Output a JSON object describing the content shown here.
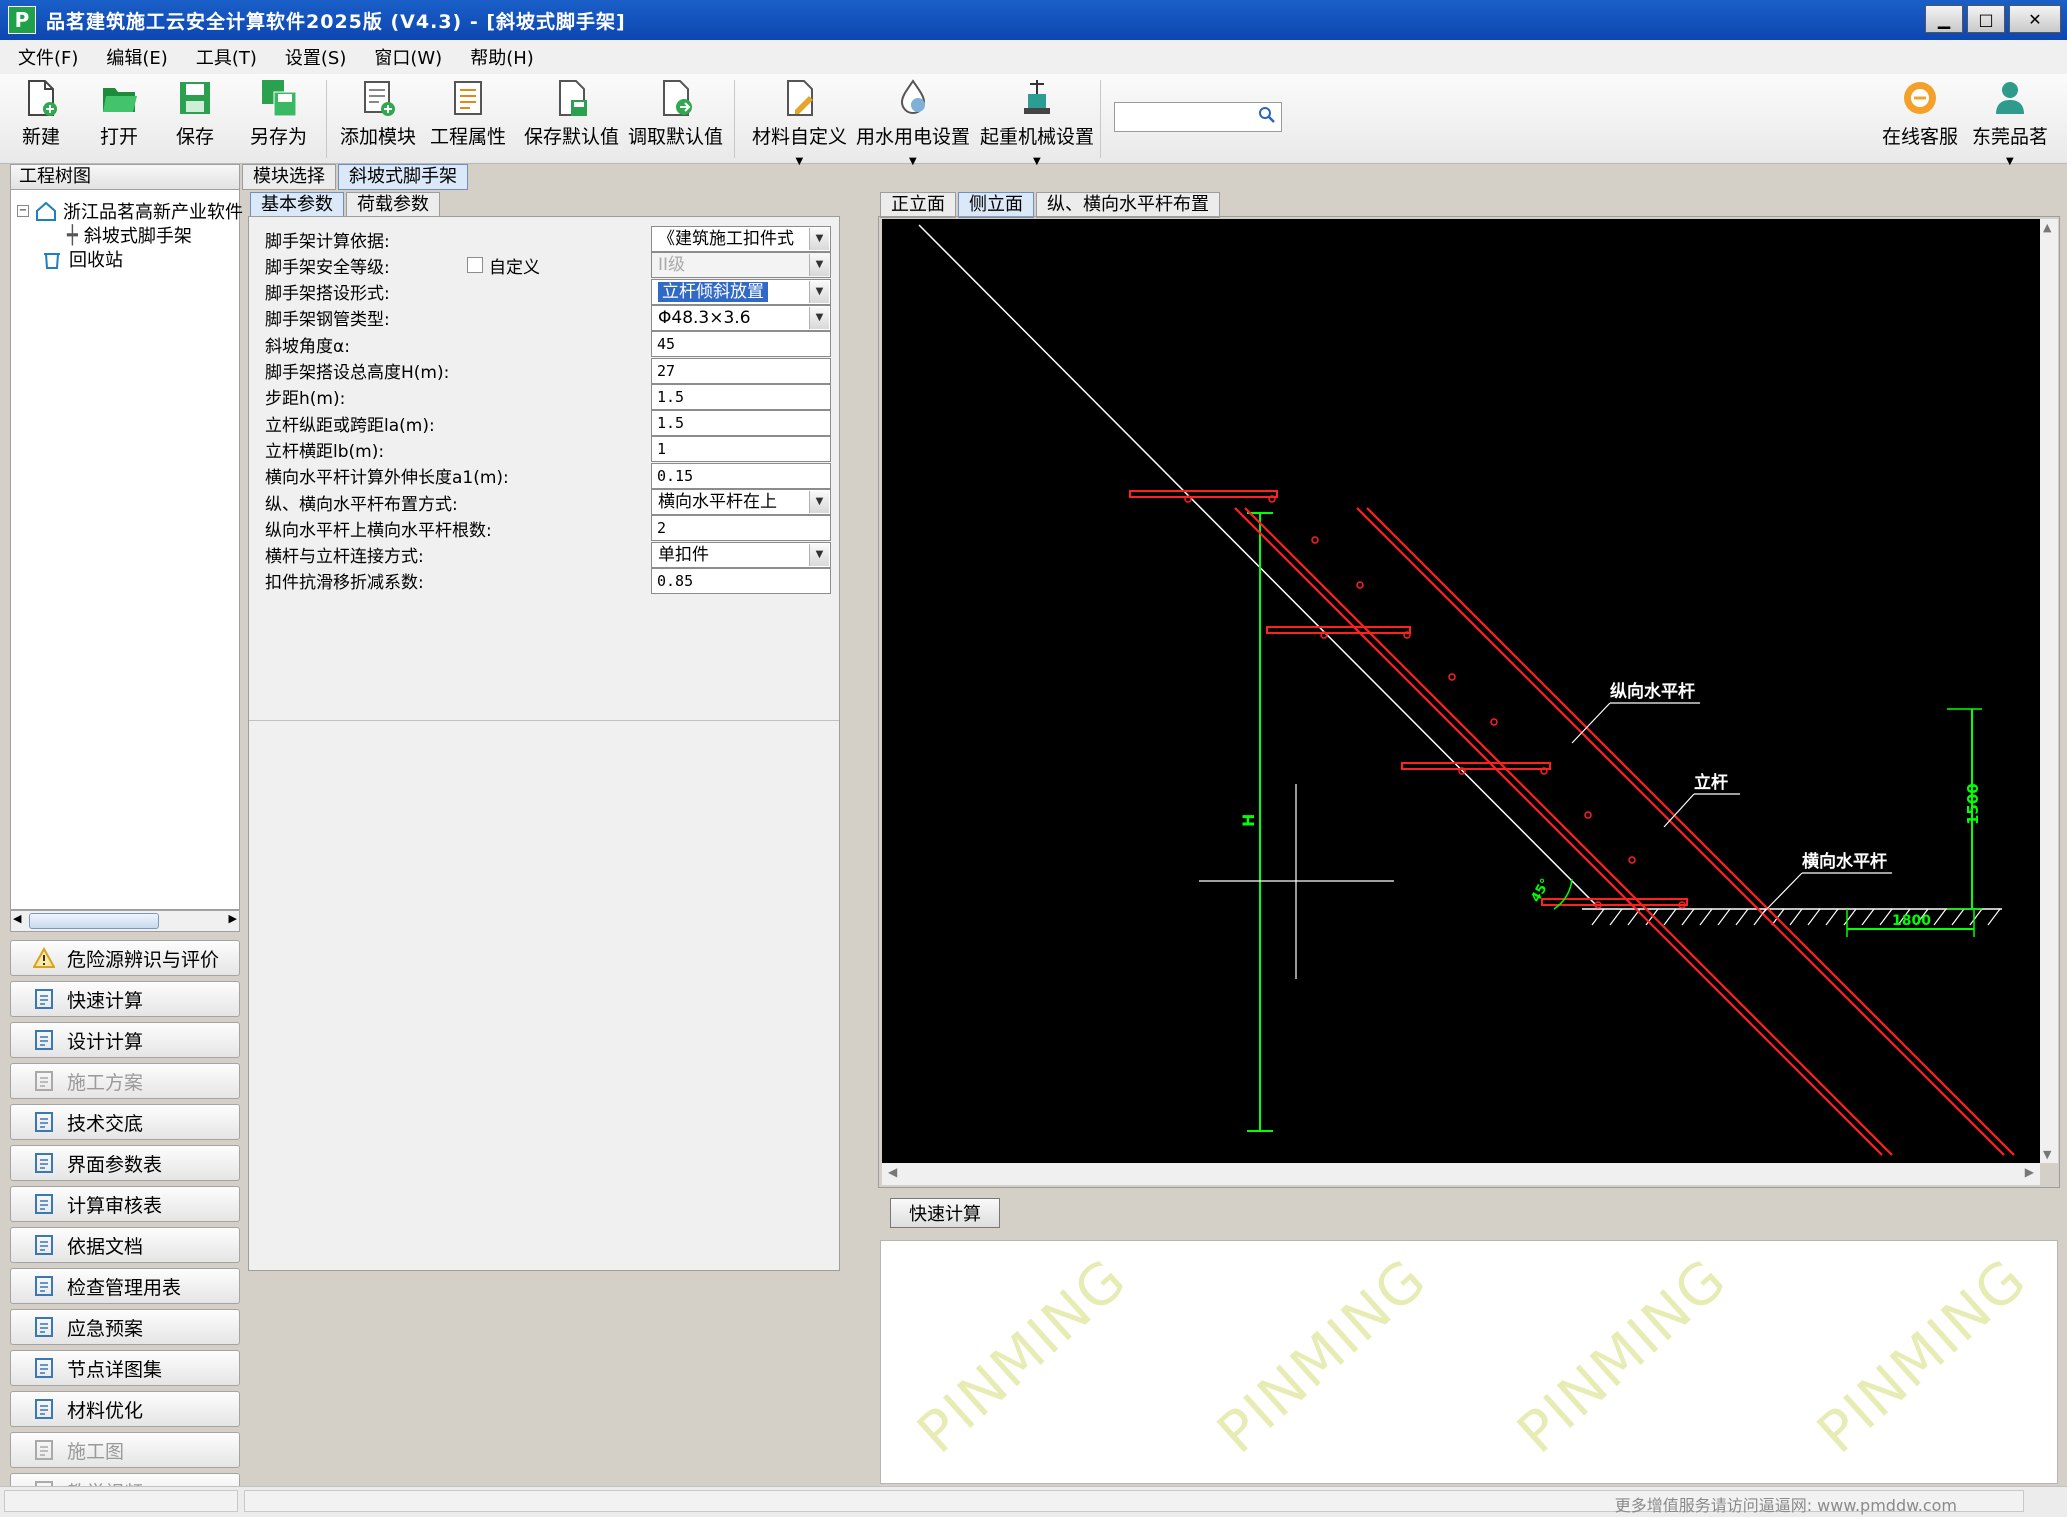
{
  "window": {
    "title": "品茗建筑施工云安全计算软件2025版 (V4.3) - [斜坡式脚手架]",
    "icon_letter": "P",
    "controls": {
      "minimize": "▁",
      "maximize": "□",
      "close": "✕"
    }
  },
  "menu": [
    "文件(F)",
    "编辑(E)",
    "工具(T)",
    "设置(S)",
    "窗口(W)",
    "帮助(H)"
  ],
  "toolbar": {
    "new": "新建",
    "open": "打开",
    "save": "保存",
    "save_as": "另存为",
    "add_module": "添加模块",
    "project_props": "工程属性",
    "save_default": "保存默认值",
    "load_default": "调取默认值",
    "material_custom": "材料自定义",
    "water_power": "用水用电设置",
    "crane": "起重机械设置",
    "search_value": "",
    "online_service": "在线客服",
    "dongguan": "东莞品茗"
  },
  "project_tree": {
    "header": "工程树图",
    "items": [
      "浙江品茗高新产业软件",
      "斜坡式脚手架",
      "回收站"
    ]
  },
  "side_menu": [
    {
      "label": "危险源辨识与评价",
      "icon": "warning-icon",
      "disabled": false
    },
    {
      "label": "快速计算",
      "icon": "calculator-icon",
      "disabled": false
    },
    {
      "label": "设计计算",
      "icon": "tools-icon",
      "disabled": false
    },
    {
      "label": "施工方案",
      "icon": "document-icon",
      "disabled": true
    },
    {
      "label": "技术交底",
      "icon": "monitor-icon",
      "disabled": false
    },
    {
      "label": "界面参数表",
      "icon": "table-icon",
      "disabled": false
    },
    {
      "label": "计算审核表",
      "icon": "audit-icon",
      "disabled": false
    },
    {
      "label": "依据文档",
      "icon": "file-icon",
      "disabled": false
    },
    {
      "label": "检查管理用表",
      "icon": "checklist-icon",
      "disabled": false
    },
    {
      "label": "应急预案",
      "icon": "emergency-icon",
      "disabled": false
    },
    {
      "label": "节点详图集",
      "icon": "node-icon",
      "disabled": false
    },
    {
      "label": "材料优化",
      "icon": "chart-icon",
      "disabled": false
    },
    {
      "label": "施工图",
      "icon": "drawing-icon",
      "disabled": true
    },
    {
      "label": "教学视频",
      "icon": "video-icon",
      "disabled": true
    }
  ],
  "module_tabs": [
    "模块选择",
    "斜坡式脚手架"
  ],
  "param_tabs": [
    "基本参数",
    "荷载参数"
  ],
  "params": [
    {
      "label": "脚手架计算依据:",
      "value": "《建筑施工扣件式",
      "type": "select"
    },
    {
      "label": "脚手架安全等级:",
      "value": "II级",
      "type": "select-disabled",
      "checkbox_label": "自定义"
    },
    {
      "label": "脚手架搭设形式:",
      "value": "立杆倾斜放置",
      "type": "select-highlight"
    },
    {
      "label": "脚手架钢管类型:",
      "value": "Φ48.3×3.6",
      "type": "select"
    },
    {
      "label": "斜坡角度α:",
      "value": "45",
      "type": "input"
    },
    {
      "label": "脚手架搭设总高度H(m):",
      "value": "27",
      "type": "input"
    },
    {
      "label": "步距h(m):",
      "value": "1.5",
      "type": "input"
    },
    {
      "label": "立杆纵距或跨距la(m):",
      "value": "1.5",
      "type": "input"
    },
    {
      "label": "立杆横距lb(m):",
      "value": "1",
      "type": "input"
    },
    {
      "label": "横向水平杆计算外伸长度a1(m):",
      "value": "0.15",
      "type": "input"
    },
    {
      "label": "纵、横向水平杆布置方式:",
      "value": "横向水平杆在上",
      "type": "select"
    },
    {
      "label": "纵向水平杆上横向水平杆根数:",
      "value": "2",
      "type": "input"
    },
    {
      "label": "横杆与立杆连接方式:",
      "value": "单扣件",
      "type": "select"
    },
    {
      "label": "扣件抗滑移折减系数:",
      "value": "0.85",
      "type": "input"
    }
  ],
  "view_tabs": [
    "正立面",
    "侧立面",
    "纵、横向水平杆布置"
  ],
  "drawing": {
    "label_longitudinal": "纵向水平杆",
    "label_upright": "立杆",
    "label_transverse": "横向水平杆",
    "dim_height": "H",
    "dim_step": "1500",
    "dim_width": "1800",
    "dim_angle": "45°",
    "colors": {
      "bar": "#ff2020",
      "dim": "#00ff00",
      "line": "#ffffff"
    }
  },
  "quick_calc_button": "快速计算",
  "watermark": "PINMING",
  "status": "更多增值服务请访问逼逼网: www.pmddw.com"
}
